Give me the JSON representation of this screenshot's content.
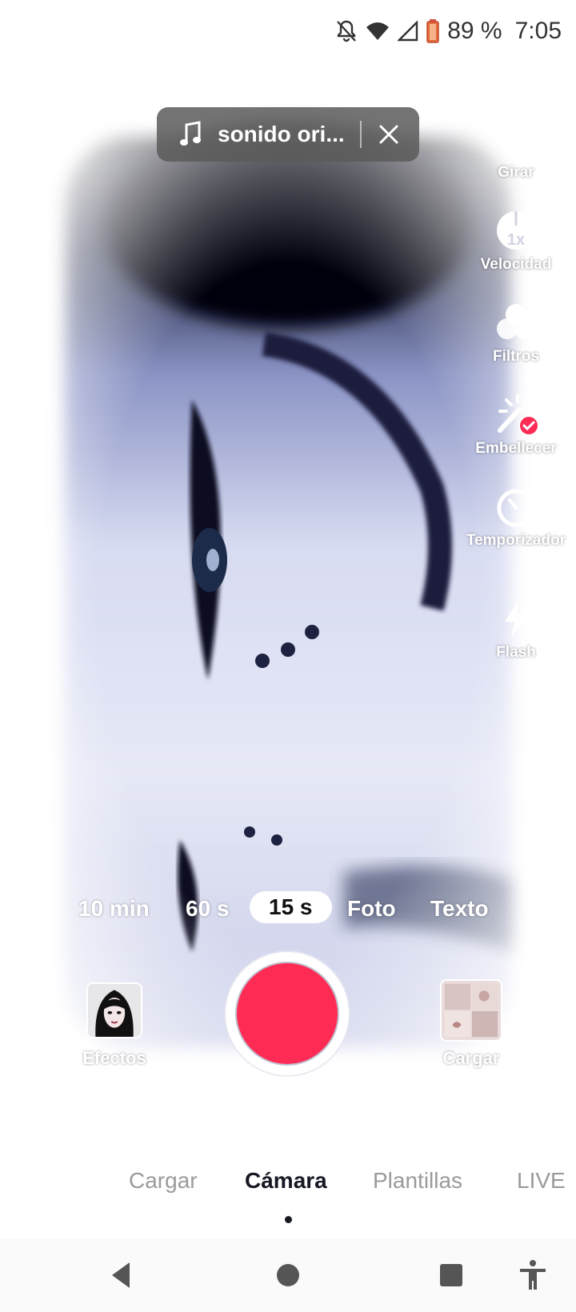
{
  "status_bar": {
    "battery": "89 %",
    "time": "7:05",
    "icons": [
      "notifications-off-icon",
      "wifi-icon",
      "signal-icon",
      "battery-icon"
    ]
  },
  "sound": {
    "label": "sonido ori...",
    "icon": "music-note-icon"
  },
  "tools": [
    {
      "label": "Girar",
      "icon": "flip-camera-icon"
    },
    {
      "label": "Velocidad",
      "icon": "speed-icon",
      "badge": "1x"
    },
    {
      "label": "Filtros",
      "icon": "filters-icon"
    },
    {
      "label": "Embellecer",
      "icon": "beautify-icon"
    },
    {
      "label": "Temporizador",
      "icon": "timer-icon"
    },
    {
      "label": "Flash",
      "icon": "flash-icon"
    }
  ],
  "durations": {
    "items": [
      "10 min",
      "60 s",
      "15 s",
      "Foto",
      "Texto"
    ],
    "selected": "15 s"
  },
  "effects_label": "Efectos",
  "upload_label": "Cargar",
  "modes": {
    "items": [
      "Cargar",
      "Cámara",
      "Plantillas",
      "LIVE"
    ],
    "selected": "Cámara"
  },
  "colors": {
    "record": "#fe2c55",
    "accent_check": "#fe2c55",
    "text_dark": "#161823",
    "text_muted": "#9a9a9a"
  },
  "system_nav": [
    "back-icon",
    "home-icon",
    "recents-icon",
    "accessibility-icon"
  ]
}
